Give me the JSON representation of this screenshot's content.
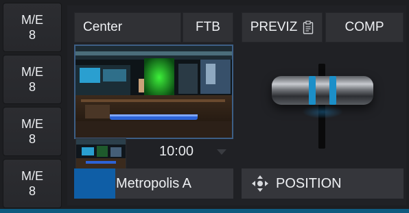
{
  "me_buttons": [
    {
      "line1": "M/E",
      "line2": "8"
    },
    {
      "line1": "M/E",
      "line2": "8"
    },
    {
      "line1": "M/E",
      "line2": "8"
    },
    {
      "line1": "M/E",
      "line2": "8"
    }
  ],
  "top_row": {
    "center_label": "Center",
    "ftb_label": "FTB",
    "previz_label": "PREVIZ",
    "comp_label": "COMP"
  },
  "preview": {
    "duration": "10:00"
  },
  "source": {
    "label": "Metropolis A",
    "progress": 0.26
  },
  "position": {
    "label": "POSITION"
  },
  "icons": {
    "previz": "clipboard-icon",
    "position": "move-arrows-icon",
    "duration_dropdown": "chevron-down-icon"
  },
  "colors": {
    "accent_blue": "#0f5ea6",
    "tbar_blue": "#1c8fc8",
    "preview_border": "#3d5f86"
  }
}
